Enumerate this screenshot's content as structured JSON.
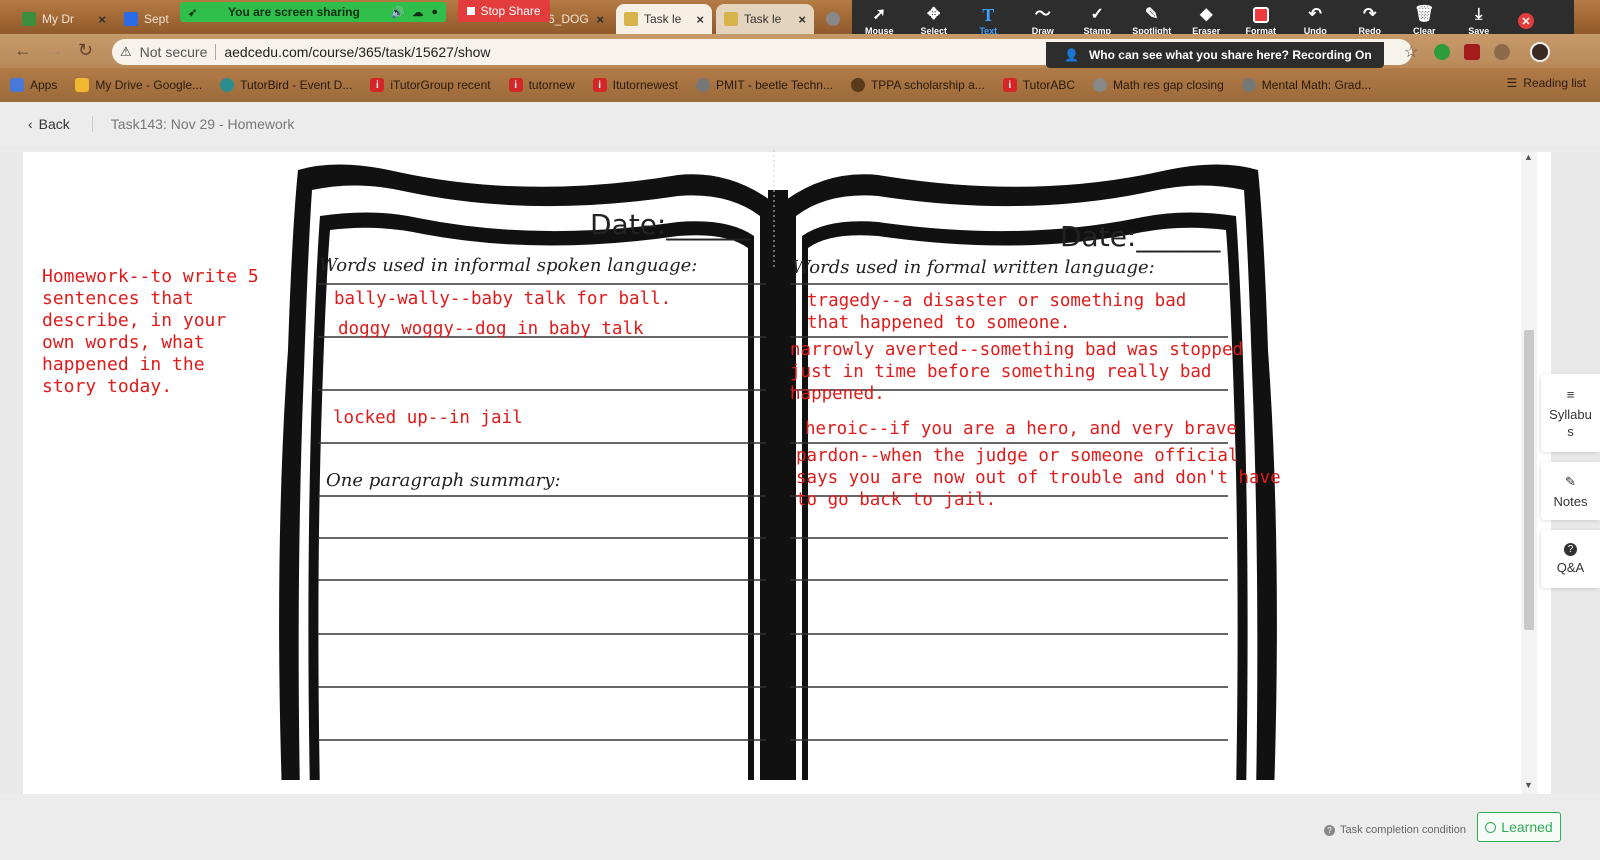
{
  "tabs": [
    {
      "label": "My Dr",
      "favicon_color": "#3c8d3c",
      "active": false
    },
    {
      "label": "Sept 2",
      "favicon_color": "#2c6be6",
      "active": false
    },
    {
      "label": "6_DOG",
      "favicon_color": "#555555",
      "active": false
    },
    {
      "label": "Task le",
      "favicon_color": "#d8b24a",
      "active": true
    },
    {
      "label": "Task le",
      "favicon_color": "#d8b24a",
      "active": true
    }
  ],
  "share": {
    "message": "You are screen sharing",
    "stop_label": "Stop Share"
  },
  "annotate_tools": [
    {
      "icon": "mouse-pointer-icon",
      "glyph": "➚",
      "label": "Mouse"
    },
    {
      "icon": "move-icon",
      "glyph": "✥",
      "label": "Select"
    },
    {
      "icon": "text-icon",
      "glyph": "T",
      "label": "Text"
    },
    {
      "icon": "draw-icon",
      "glyph": "〜",
      "label": "Draw"
    },
    {
      "icon": "stamp-icon",
      "glyph": "✓",
      "label": "Stamp"
    },
    {
      "icon": "spotlight-icon",
      "glyph": "✎",
      "label": "Spotlight"
    },
    {
      "icon": "eraser-icon",
      "glyph": "◆",
      "label": "Eraser"
    },
    {
      "icon": "format-icon",
      "glyph": "",
      "label": "Format"
    },
    {
      "icon": "undo-icon",
      "glyph": "↶",
      "label": "Undo"
    },
    {
      "icon": "redo-icon",
      "glyph": "↷",
      "label": "Redo"
    },
    {
      "icon": "trash-icon",
      "glyph": "🗑",
      "label": "Clear"
    },
    {
      "icon": "save-icon",
      "glyph": "⤓",
      "label": "Save"
    }
  ],
  "address": {
    "security": "Not secure",
    "url": "aedcedu.com/course/365/task/15627/show"
  },
  "recording_banner": "Who can see what you share here? Recording On",
  "bookmarks": [
    {
      "label": "Apps",
      "color": "#4a78d8"
    },
    {
      "label": "My Drive - Google...",
      "color": "#f2b730"
    },
    {
      "label": "TutorBird - Event D...",
      "color": "#2a8e8e"
    },
    {
      "label": "iTutorGroup recent",
      "color": "#d42626"
    },
    {
      "label": "tutornew",
      "color": "#d42626"
    },
    {
      "label": "Itutornewest",
      "color": "#d42626"
    },
    {
      "label": "PMIT - beetle Techn...",
      "color": "#777777"
    },
    {
      "label": "TPPA scholarship a...",
      "color": "#5b3a1a"
    },
    {
      "label": "TutorABC",
      "color": "#d42626"
    },
    {
      "label": "Math res gap closing",
      "color": "#888888"
    },
    {
      "label": "Mental Math: Grad...",
      "color": "#777777"
    }
  ],
  "reading_list": "Reading list",
  "page": {
    "back_label": "Back",
    "breadcrumb": "Task143:  Nov 29 - Homework"
  },
  "homework_note": "Homework--to write 5 sentences that describe, in your own words, what happened in the story today.",
  "worksheet": {
    "left": {
      "date_label": "Date:______",
      "heading": "Words used in informal spoken language:",
      "summary_heading": "One paragraph summary:",
      "entries": [
        "bally-wally--baby talk for ball.",
        "doggy woggy--dog in baby talk",
        "locked up--in jail"
      ]
    },
    "right": {
      "date_label": "Date:______",
      "heading": "Words used in formal written language:",
      "entries": [
        "tragedy--a disaster or something bad\nthat happened to someone.",
        "narrowly averted--something bad was stopped\njust in time before something really bad\nhappened.",
        "heroic--if you are a hero, and very brave",
        "pardon--when the judge or someone official\nsays you are now out of trouble and don't have\nto go back to jail."
      ]
    }
  },
  "side_tabs": [
    {
      "icon": "menu-icon",
      "glyph": "≡",
      "label": "Syllabu\ns"
    },
    {
      "icon": "pencil-icon",
      "glyph": "✎",
      "label": "Notes"
    },
    {
      "icon": "question-icon",
      "glyph": "?",
      "label": "Q&A"
    }
  ],
  "footer": {
    "completion": "Task completion condition",
    "learned": "Learned"
  },
  "colors": {
    "annotation_red": "#e01b1b",
    "learned_green": "#2eab55"
  }
}
